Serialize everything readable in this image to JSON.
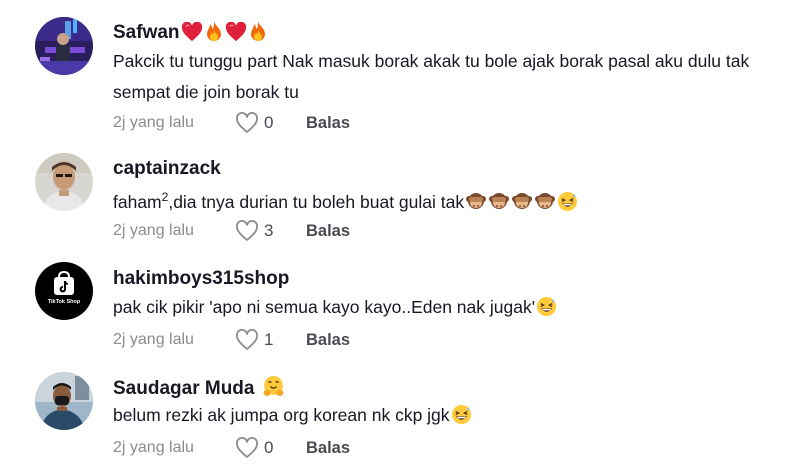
{
  "comments": [
    {
      "username": "Safwan",
      "username_emoji": [
        "heart-icon",
        "fire-icon",
        "heart-icon",
        "fire-icon"
      ],
      "text": "Pakcik tu tunggu part Nak masuk borak akak tu bole ajak borak pasal aku dulu tak sempat die join borak tu",
      "time": "2j yang lalu",
      "likes": "0",
      "reply": "Balas"
    },
    {
      "username": "captainzack",
      "text_before_sup": "faham",
      "text_sup": "2",
      "text": ",dia tnya durian tu boleh buat gulai tak",
      "text_emoji": [
        "see-no-evil-monkey-icon",
        "see-no-evil-monkey-icon",
        "see-no-evil-monkey-icon",
        "see-no-evil-monkey-icon",
        "laughing-sweat-icon"
      ],
      "time": "2j yang lalu",
      "likes": "3",
      "reply": "Balas"
    },
    {
      "username": "hakimboys315shop",
      "avatar_text": "TikTok Shop",
      "text": "pak cik pikir 'apo ni semua kayo kayo..Eden nak jugak'",
      "text_emoji": [
        "laughing-sweat-icon"
      ],
      "time": "2j yang lalu",
      "likes": "1",
      "reply": "Balas"
    },
    {
      "username": "Saudagar Muda",
      "username_emoji": [
        "hugging-face-icon"
      ],
      "text": "belum rezki ak jumpa org korean nk ckp jgk",
      "text_emoji": [
        "laughing-sweat-icon"
      ],
      "time": "2j yang lalu",
      "likes": "0",
      "reply": "Balas"
    }
  ],
  "colors": {
    "primary_text": "#161823",
    "secondary_text": "#8a8b91",
    "action_text": "#4a4b52",
    "heart_red": "#e8112d"
  }
}
